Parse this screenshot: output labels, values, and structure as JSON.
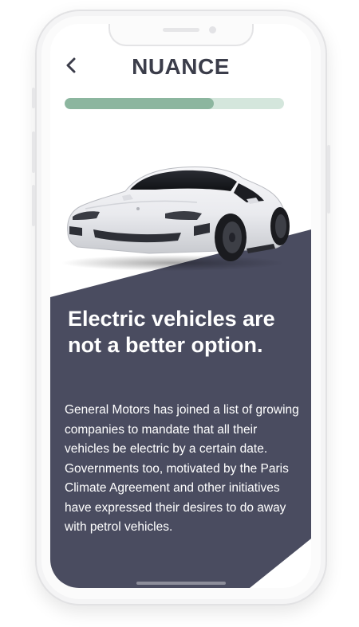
{
  "app": {
    "title": "NUANCE"
  },
  "progress": {
    "value": 0.68
  },
  "article": {
    "headline": "Electric vehicles are not a better option.",
    "body": "General Motors has joined a list of growing companies to mandate that all their vehicles be electric by a certain date. Governments too, motivated by the Paris Climate Agreement and other initiatives have expressed their desires to do away with petrol vehicles."
  },
  "icons": {
    "back": "chevron-left-icon",
    "hero": "car-image"
  },
  "colors": {
    "title": "#3b3d4a",
    "progress_track": "#d4e6dc",
    "progress_fill": "#8cb69f",
    "panel": "#4a4c60",
    "text_on_panel": "#ffffff"
  }
}
